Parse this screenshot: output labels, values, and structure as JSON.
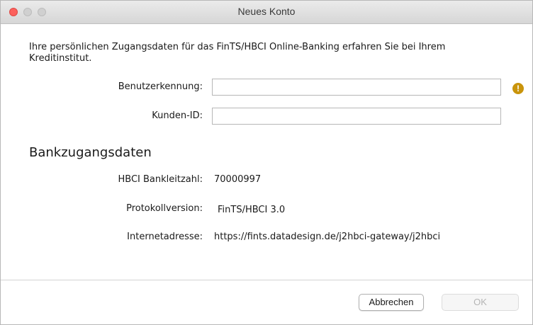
{
  "window": {
    "title": "Neues Konto"
  },
  "intro_text": "Ihre persönlichen Zugangsdaten für das FinTS/HBCI Online-Banking erfahren Sie bei Ihrem Kreditinstitut.",
  "fields": {
    "user_id_label": "Benutzerkennung:",
    "user_id_value": "",
    "customer_id_label": "Kunden-ID:",
    "customer_id_value": "",
    "warning_glyph": "!",
    "warning_color": "#c9940b"
  },
  "bank_section": {
    "heading": "Bankzugangsdaten",
    "blz_label": "HBCI Bankleitzahl:",
    "blz_value": "70000997",
    "protocol_label": "Protokollversion:",
    "protocol_value": "FinTS/HBCI 3.0",
    "url_label": "Internetadresse:",
    "url_value": "https://fints.datadesign.de/j2hbci-gateway/j2hbci"
  },
  "buttons": {
    "cancel_label": "Abbrechen",
    "ok_label": "OK"
  },
  "icons": {
    "close": "close-icon",
    "minimize": "minimize-icon",
    "maximize": "maximize-icon",
    "warning": "warning-icon"
  }
}
